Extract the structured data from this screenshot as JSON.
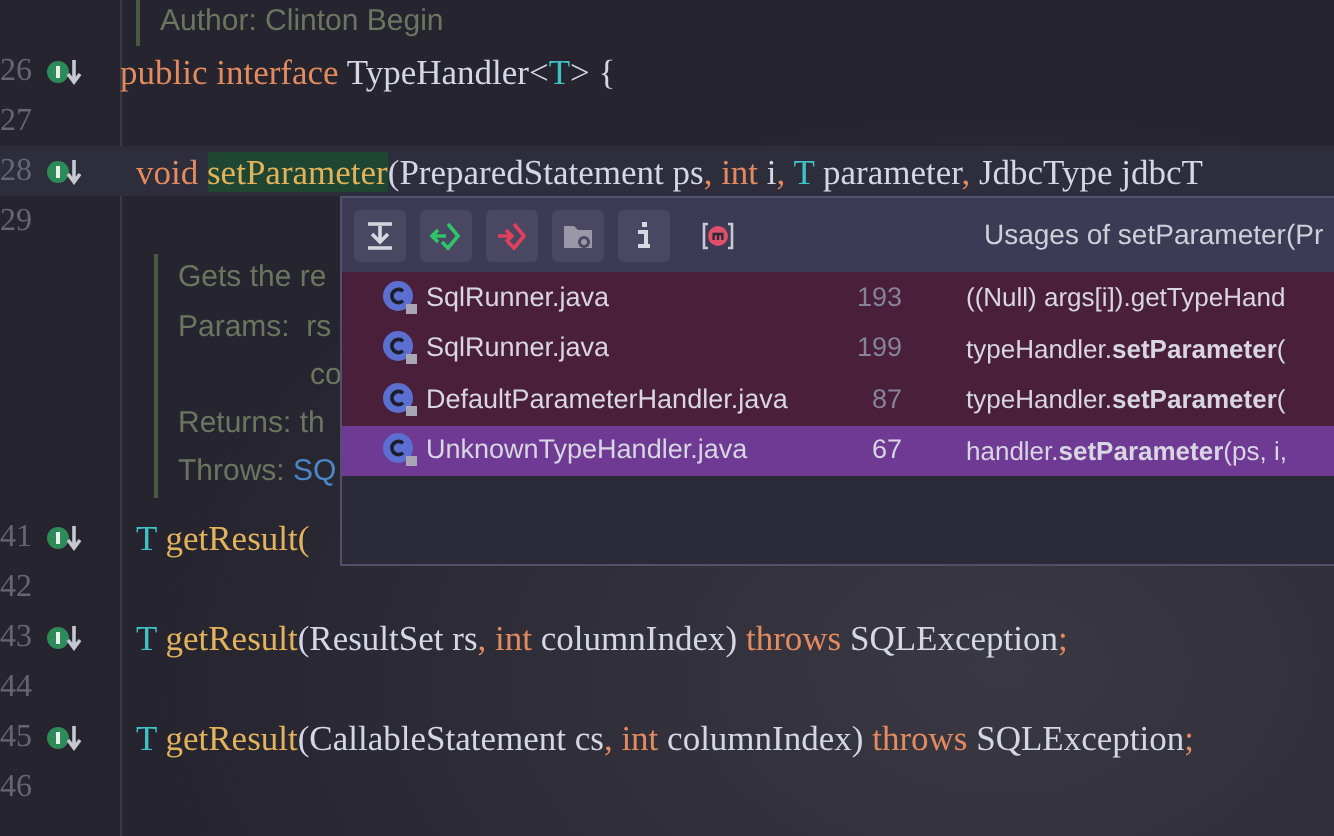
{
  "editor": {
    "items": [
      {
        "kind": "doc",
        "lines": [
          [
            {
              "text": "Author: Clinton Begin"
            }
          ]
        ]
      },
      {
        "kind": "code",
        "number": "26",
        "marker": true,
        "current": false,
        "indented": false,
        "tokens": [
          {
            "kind": "keyword",
            "text": "public interface "
          },
          {
            "kind": "plain",
            "text": "TypeHandler<"
          },
          {
            "kind": "typevar",
            "text": "T"
          },
          {
            "kind": "plain",
            "text": "> {"
          }
        ]
      },
      {
        "kind": "code",
        "number": "27",
        "marker": false,
        "current": false
      },
      {
        "kind": "code",
        "number": "28",
        "marker": true,
        "current": true,
        "indented": true,
        "tokens": [
          {
            "kind": "keyword",
            "text": "void "
          },
          {
            "kind": "method",
            "text": "setParameter",
            "highlighted": true
          },
          {
            "kind": "plain",
            "text": "(PreparedStatement ps"
          },
          {
            "kind": "keyword",
            "text": ", int "
          },
          {
            "kind": "plain",
            "text": "i"
          },
          {
            "kind": "keyword",
            "text": ", "
          },
          {
            "kind": "typevar",
            "text": "T "
          },
          {
            "kind": "plain",
            "text": "parameter"
          },
          {
            "kind": "keyword",
            "text": ", "
          },
          {
            "kind": "plain",
            "text": "JdbcType jdbcT"
          }
        ]
      },
      {
        "kind": "code",
        "number": "29",
        "marker": false,
        "current": false
      },
      {
        "kind": "doc",
        "lines": [
          [
            {
              "text": "Gets the re"
            }
          ],
          [
            {
              "text": "Params:  rs"
            }
          ],
          [
            {
              "text": "co",
              "continued": true
            }
          ],
          [
            {
              "text": "Returns: th"
            }
          ],
          [
            {
              "text": "Throws: "
            },
            {
              "text": "SQ",
              "link": true
            }
          ]
        ]
      },
      {
        "kind": "code",
        "number": "41",
        "marker": true,
        "current": false,
        "indented": true,
        "tokens": [
          {
            "kind": "typevar",
            "text": "T "
          },
          {
            "kind": "method",
            "text": "getResult("
          }
        ]
      },
      {
        "kind": "code",
        "number": "42",
        "marker": false,
        "current": false
      },
      {
        "kind": "code",
        "number": "43",
        "marker": true,
        "current": false,
        "indented": true,
        "tokens": [
          {
            "kind": "typevar",
            "text": "T "
          },
          {
            "kind": "method",
            "text": "getResult"
          },
          {
            "kind": "plain",
            "text": "(ResultSet rs"
          },
          {
            "kind": "keyword",
            "text": ", int "
          },
          {
            "kind": "plain",
            "text": "columnIndex) "
          },
          {
            "kind": "keyword",
            "text": "throws "
          },
          {
            "kind": "plain",
            "text": "SQLException"
          },
          {
            "kind": "keyword",
            "text": ";"
          }
        ]
      },
      {
        "kind": "code",
        "number": "44",
        "marker": false,
        "current": false
      },
      {
        "kind": "code",
        "number": "45",
        "marker": true,
        "current": false,
        "indented": true,
        "tokens": [
          {
            "kind": "typevar",
            "text": "T "
          },
          {
            "kind": "method",
            "text": "getResult"
          },
          {
            "kind": "plain",
            "text": "(CallableStatement cs"
          },
          {
            "kind": "keyword",
            "text": ", int "
          },
          {
            "kind": "plain",
            "text": "columnIndex) "
          },
          {
            "kind": "keyword",
            "text": "throws "
          },
          {
            "kind": "plain",
            "text": "SQLException"
          },
          {
            "kind": "keyword",
            "text": ";"
          }
        ]
      },
      {
        "kind": "code",
        "number": "46",
        "marker": false,
        "current": false
      }
    ]
  },
  "usages_popup": {
    "toolbar": [
      {
        "kind": "pin"
      },
      {
        "kind": "previous"
      },
      {
        "kind": "next"
      },
      {
        "kind": "scope"
      },
      {
        "kind": "info"
      },
      {
        "kind": "method-filter"
      }
    ],
    "title": "Usages of setParameter(Pr",
    "rows": [
      {
        "file": "SqlRunner.java",
        "line": "193",
        "usage": "((Null) args[i]).getTypeHand",
        "selected": false
      },
      {
        "file": "SqlRunner.java",
        "line": "199",
        "usage": "typeHandler.**setParameter**(",
        "selected": false
      },
      {
        "file": "DefaultParameterHandler.java",
        "line": "87",
        "usage": "typeHandler.**setParameter**(",
        "selected": false
      },
      {
        "file": "UnknownTypeHandler.java",
        "line": "67",
        "usage": "handler.**setParameter**(ps, i,",
        "selected": true
      }
    ]
  }
}
